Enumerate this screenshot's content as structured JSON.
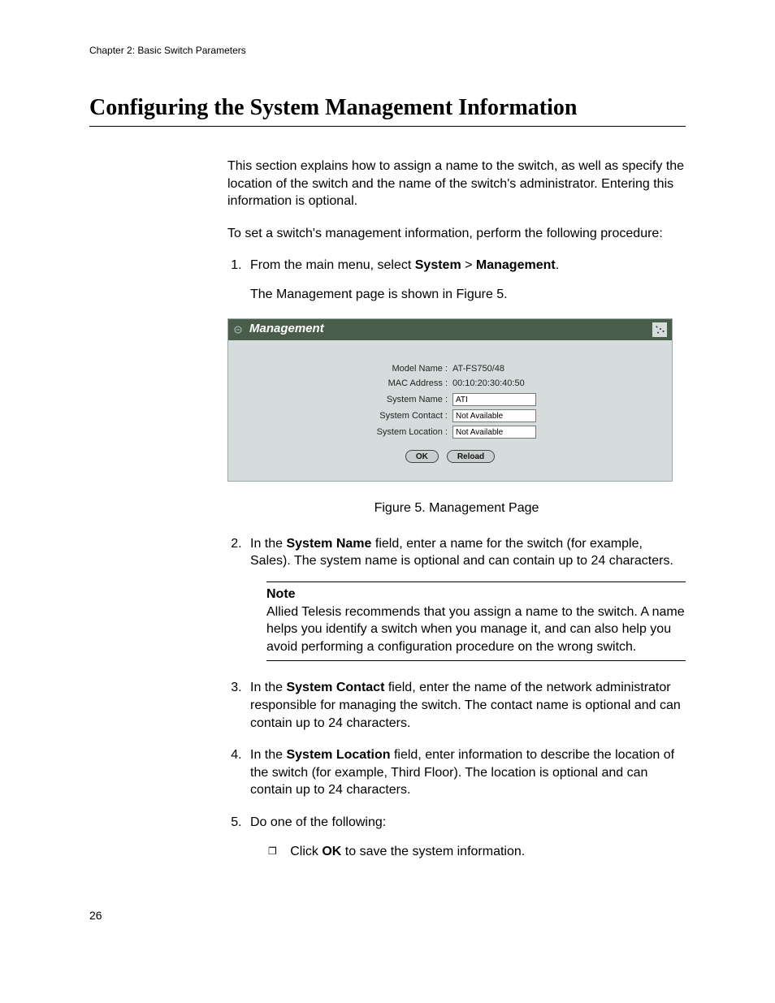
{
  "chapter_header": "Chapter 2: Basic Switch Parameters",
  "section_title": "Configuring the System Management Information",
  "intro_p1": "This section explains how to assign a name to the switch, as well as specify the location of the switch and the name of the switch's administrator. Entering this information is optional.",
  "intro_p2": "To set a switch's management information, perform the following procedure:",
  "step1_pre": "From the main menu, select ",
  "step1_bold1": "System",
  "step1_mid": " > ",
  "step1_bold2": "Management",
  "step1_post": ".",
  "step1_p2": "The Management page is shown in Figure 5.",
  "figure": {
    "title": "Management",
    "rows": {
      "model_label": "Model Name :",
      "model_value": "AT-FS750/48",
      "mac_label": "MAC Address :",
      "mac_value": "00:10:20:30:40:50",
      "sysname_label": "System Name :",
      "sysname_value": "ATI",
      "syscontact_label": "System Contact :",
      "syscontact_value": "Not Available",
      "sysloc_label": "System Location :",
      "sysloc_value": "Not Available"
    },
    "ok_label": "OK",
    "reload_label": "Reload",
    "caption": "Figure 5. Management Page"
  },
  "step2_pre": "In the ",
  "step2_bold": "System Name",
  "step2_post": " field, enter a name for the switch (for example, Sales). The system name is optional and can contain up to 24 characters.",
  "note_label": "Note",
  "note_body": "Allied Telesis recommends that you assign a name to the switch. A name helps you identify a switch when you manage it, and can also help you avoid performing a configuration procedure on the wrong switch.",
  "step3_pre": "In the ",
  "step3_bold": "System Contact",
  "step3_post": " field, enter the name of the network administrator responsible for managing the switch. The contact name is optional and can contain up to 24 characters.",
  "step4_pre": "In the ",
  "step4_bold": "System Location",
  "step4_post": " field, enter information to describe the location of the switch (for example, Third Floor). The location is optional and can contain up to 24 characters.",
  "step5": "Do one of the following:",
  "step5_sub_pre": "Click ",
  "step5_sub_bold": "OK",
  "step5_sub_post": " to save the system information.",
  "page_number": "26"
}
